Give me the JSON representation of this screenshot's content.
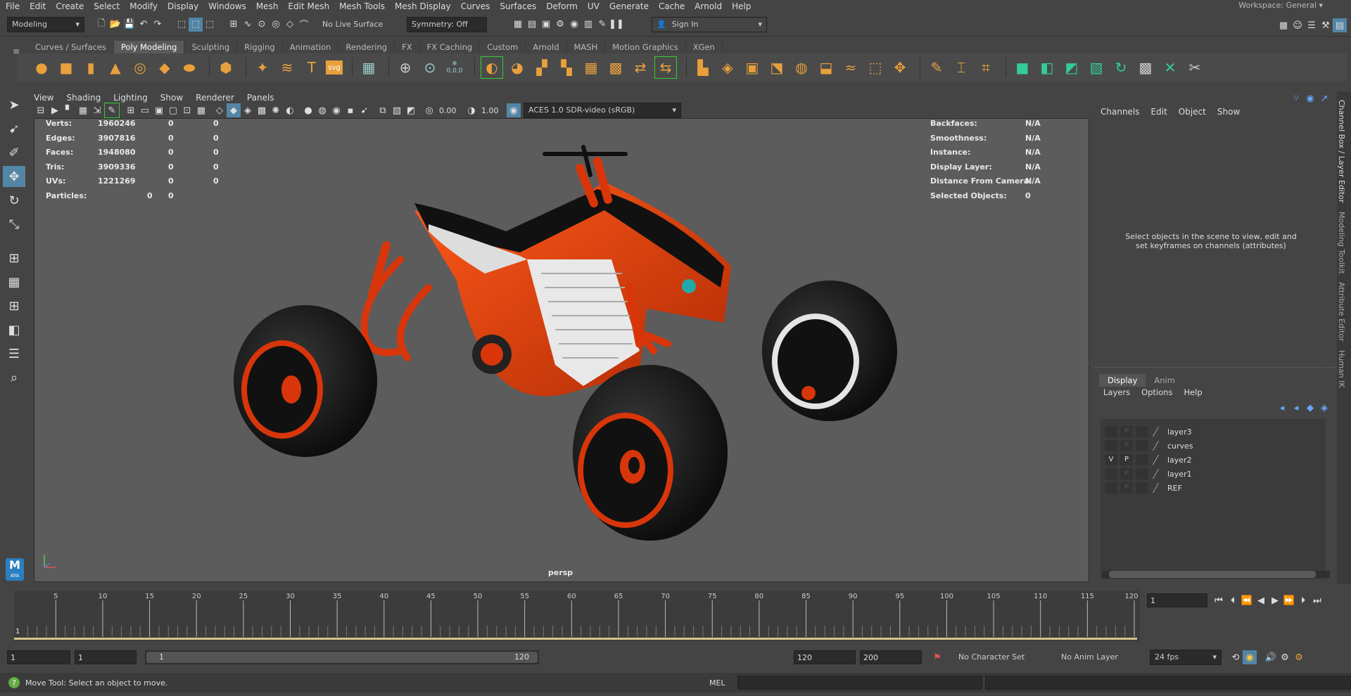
{
  "menubar": {
    "items": [
      "File",
      "Edit",
      "Create",
      "Select",
      "Modify",
      "Display",
      "Windows",
      "Mesh",
      "Edit Mesh",
      "Mesh Tools",
      "Mesh Display",
      "Curves",
      "Surfaces",
      "Deform",
      "UV",
      "Generate",
      "Cache",
      "Arnold",
      "Help"
    ],
    "workspace_label": "Workspace:",
    "workspace_value": "General"
  },
  "statusline": {
    "mode": "Modeling",
    "live_surface": "No Live Surface",
    "symmetry": "Symmetry: Off",
    "sign_in": "Sign In"
  },
  "shelf": {
    "tabs": [
      "Curves / Surfaces",
      "Poly Modeling",
      "Sculpting",
      "Rigging",
      "Animation",
      "Rendering",
      "FX",
      "FX Caching",
      "Custom",
      "Arnold",
      "MASH",
      "Motion Graphics",
      "XGen"
    ],
    "active_tab": "Poly Modeling",
    "svg_label": "svg",
    "coord_label": "0,0,0"
  },
  "viewport": {
    "menus": [
      "View",
      "Shading",
      "Lighting",
      "Show",
      "Renderer",
      "Panels"
    ],
    "field_a": "0.00",
    "field_b": "1.00",
    "color_space": "ACES 1.0 SDR-video (sRGB)",
    "camera": "persp",
    "hud_left": [
      {
        "label": "Verts:",
        "v1": "1960246",
        "v2": "0",
        "v3": "0"
      },
      {
        "label": "Edges:",
        "v1": "3907816",
        "v2": "0",
        "v3": "0"
      },
      {
        "label": "Faces:",
        "v1": "1948080",
        "v2": "0",
        "v3": "0"
      },
      {
        "label": "Tris:",
        "v1": "3909336",
        "v2": "0",
        "v3": "0"
      },
      {
        "label": "UVs:",
        "v1": "1221269",
        "v2": "0",
        "v3": "0"
      }
    ],
    "particles": {
      "label": "Particles:",
      "v1": "0",
      "v2": "0"
    },
    "hud_right": [
      {
        "label": "Backfaces:",
        "value": "N/A"
      },
      {
        "label": "Smoothness:",
        "value": "N/A"
      },
      {
        "label": "Instance:",
        "value": "N/A"
      },
      {
        "label": "Display Layer:",
        "value": "N/A"
      },
      {
        "label": "Distance From Camera:",
        "value": "N/A"
      },
      {
        "label": "Selected Objects:",
        "value": "0"
      }
    ]
  },
  "channelbox": {
    "menus": [
      "Channels",
      "Edit",
      "Object",
      "Show"
    ],
    "message": "Select objects in the scene to view, edit and set keyframes on channels (attributes)"
  },
  "layers": {
    "tabs": [
      "Display",
      "Anim"
    ],
    "menus": [
      "Layers",
      "Options",
      "Help"
    ],
    "items": [
      {
        "v": "",
        "p": "P",
        "name": "layer3"
      },
      {
        "v": "",
        "p": "P",
        "name": "curves"
      },
      {
        "v": "V",
        "p": "P",
        "name": "layer2"
      },
      {
        "v": "",
        "p": "P",
        "name": "layer1"
      },
      {
        "v": "",
        "p": "P",
        "name": "REF"
      }
    ]
  },
  "sidetabs": [
    "Channel Box / Layer Editor",
    "Modeling Toolkit",
    "Attribute Editor",
    "Human IK"
  ],
  "timeline": {
    "ticks": [
      "5",
      "10",
      "15",
      "20",
      "25",
      "30",
      "35",
      "40",
      "45",
      "50",
      "55",
      "60",
      "65",
      "70",
      "75",
      "80",
      "85",
      "90",
      "95",
      "100",
      "105",
      "110",
      "115",
      "120"
    ],
    "start_marker": "1",
    "current_frame": "1"
  },
  "range": {
    "start": "1",
    "playback_start": "1",
    "range_start_label": "1",
    "range_end_label": "120",
    "playback_end": "120",
    "end": "200",
    "character_set": "No Character Set",
    "anim_layer": "No Anim Layer",
    "fps": "24 fps"
  },
  "helpline": {
    "message": "Move Tool: Select an object to move.",
    "mel": "MEL"
  },
  "logo": "AYA"
}
